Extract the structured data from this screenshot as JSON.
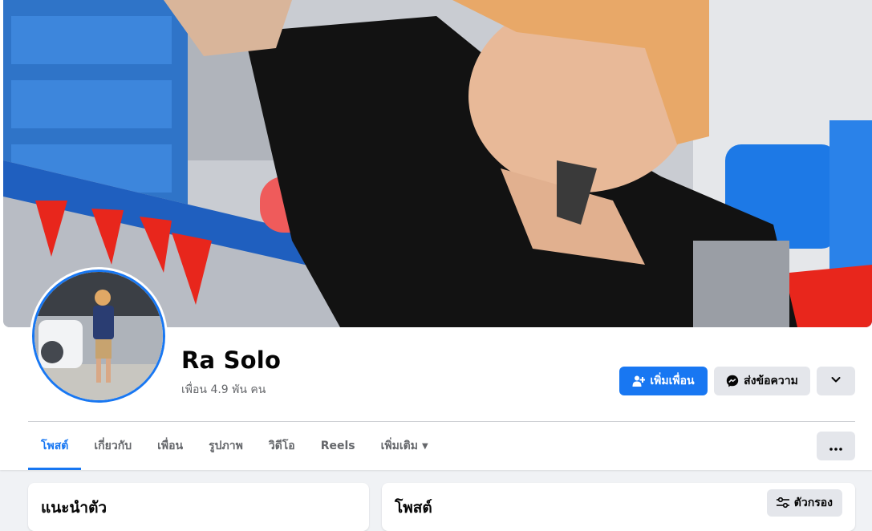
{
  "profile": {
    "name": "Ra Solo",
    "friends_count": "เพื่อน 4.9 พัน คน"
  },
  "actions": {
    "add_friend_label": "เพิ่มเพื่อน",
    "message_label": "ส่งข้อความ"
  },
  "tabs": [
    {
      "label": "โพสต์",
      "active": true
    },
    {
      "label": "เกี่ยวกับ",
      "active": false
    },
    {
      "label": "เพื่อน",
      "active": false
    },
    {
      "label": "รูปภาพ",
      "active": false
    },
    {
      "label": "วิดีโอ",
      "active": false
    },
    {
      "label": "Reels",
      "active": false
    },
    {
      "label": "เพิ่มเติม",
      "active": false
    }
  ],
  "intro_card": {
    "title": "แนะนำตัว"
  },
  "posts_card": {
    "title": "โพสต์",
    "filter_label": "ตัวกรอง"
  },
  "icons": {
    "add_friend": "add-person-icon",
    "message": "messenger-icon",
    "more": "chevron-down-icon",
    "tab_more": "caret-down-icon",
    "options": "three-dots-icon",
    "filter": "sliders-icon"
  },
  "colors": {
    "accent": "#1877f2",
    "secondary_button": "#e4e6eb",
    "page_background": "#f0f2f5",
    "muted_text": "#65676b"
  }
}
